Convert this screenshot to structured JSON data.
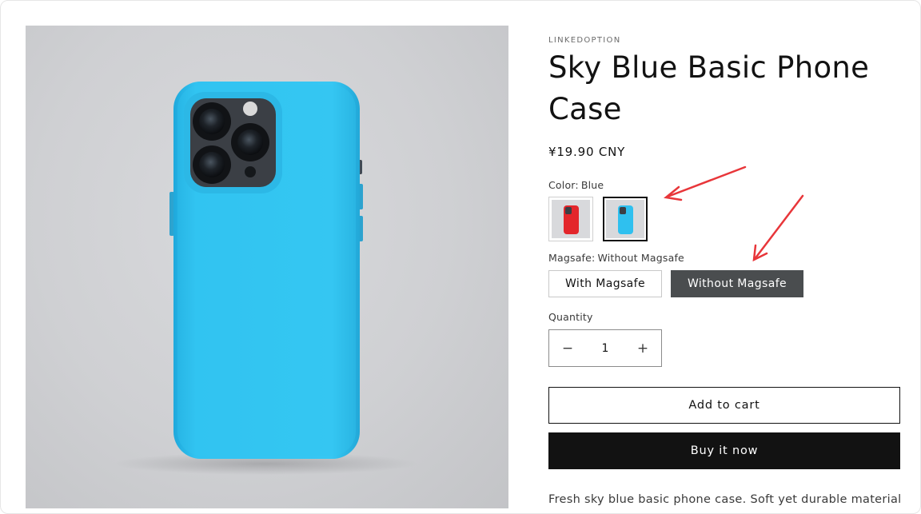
{
  "product": {
    "vendor": "LINKEDOPTION",
    "title": "Sky Blue Basic Phone Case",
    "price": "¥19.90 CNY",
    "description": "Fresh sky blue basic phone case. Soft yet durable material"
  },
  "options": {
    "color": {
      "label": "Color:",
      "selected": "Blue",
      "swatches": [
        {
          "name": "Red",
          "color": "#e3262b"
        },
        {
          "name": "Blue",
          "color": "#2fb8e8"
        }
      ]
    },
    "magsafe": {
      "label": "Magsafe:",
      "selected": "Without Magsafe",
      "values": [
        "With Magsafe",
        "Without Magsafe"
      ]
    }
  },
  "quantity": {
    "label": "Quantity",
    "value": "1",
    "decrease_symbol": "−",
    "increase_symbol": "+"
  },
  "actions": {
    "add_to_cart": "Add to cart",
    "buy_now": "Buy it now"
  },
  "colors": {
    "case_blue": "#2fc0ef",
    "annotation_red": "#e8363a",
    "selected_pill": "#4a4d4f",
    "primary": "#121212"
  }
}
